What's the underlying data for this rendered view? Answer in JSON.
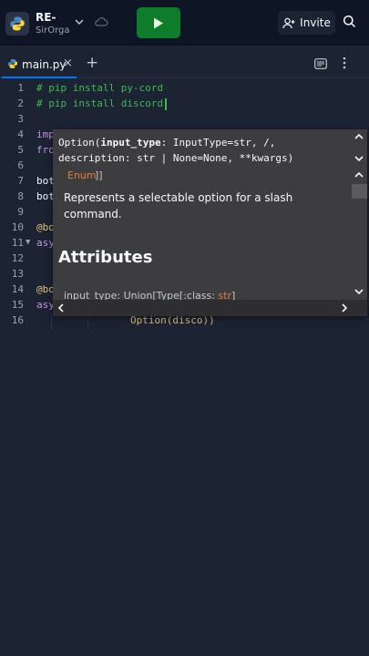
{
  "header": {
    "repl_title": "RE-",
    "repl_owner": "SirOrga",
    "invite_label": "Invite"
  },
  "tab": {
    "filename": "main.py",
    "close_glyph": "×",
    "add_glyph": "+"
  },
  "editor": {
    "line_numbers": [
      "1",
      "2",
      "3",
      "4",
      "5",
      "6",
      "7",
      "8",
      "9",
      "10",
      "11",
      "12",
      "13",
      "14",
      "15",
      "16"
    ],
    "lines": [
      {
        "text": "# pip install py-cord",
        "kind": "comment"
      },
      {
        "text": "# pip install discord",
        "kind": "comment"
      },
      {
        "text": "",
        "kind": "code"
      },
      {
        "text": "imp",
        "kind": "code"
      },
      {
        "text": "fro",
        "kind": "code"
      },
      {
        "text": "",
        "kind": "code"
      },
      {
        "text": "bot",
        "kind": "code"
      },
      {
        "text": "bot",
        "kind": "code"
      },
      {
        "text": "",
        "kind": "code"
      },
      {
        "text": "@bo",
        "kind": "code"
      },
      {
        "text": "asy",
        "kind": "code"
      },
      {
        "text": "",
        "kind": "code"
      },
      {
        "text": "",
        "kind": "code"
      },
      {
        "text": "@bo",
        "kind": "code"
      },
      {
        "text": "asy",
        "kind": "code"
      },
      {
        "text": "Option(disco))",
        "kind": "code"
      }
    ]
  },
  "popup": {
    "signature_prefix": "Option(",
    "signature_param": "input_type",
    "signature_rest_1": ": InputType=str, /,",
    "signature_rest_2": "description: str | None=None, **kwargs)",
    "enum_tag": "Enum",
    "enum_close": "]]",
    "description": "Represents a selectable option for a slash command.",
    "attributes_heading": "Attributes",
    "attr_line_prefix": "input_type: Union[Type[:class:",
    "attr_line_kw": "str",
    "attr_line_suffix": "]"
  },
  "icons": {
    "run": "play-icon",
    "invite": "add-user-icon",
    "search": "search-icon",
    "python": "python-icon",
    "chevron": "chevron-down-icon",
    "cloud": "cloud-icon",
    "view": "view-icon",
    "more": "more-vertical-icon"
  },
  "colors": {
    "accent_green": "#0e7d2b",
    "comment_green": "#3fb950",
    "tab_underline": "#0079f2",
    "enum_orange": "#e07f3f"
  }
}
